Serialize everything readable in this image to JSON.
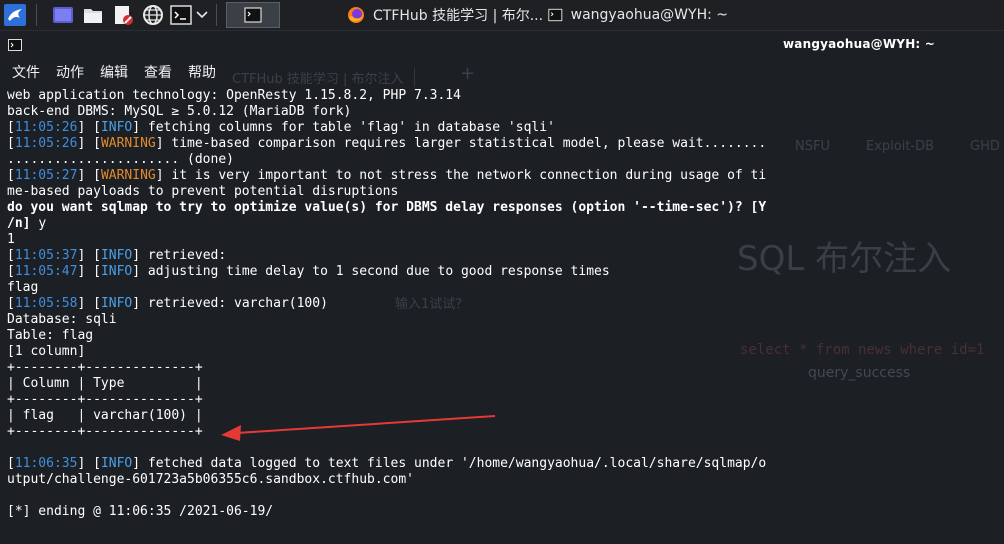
{
  "taskbar": {
    "tasks": [
      {
        "label": "CTFHub 技能学习 | 布尔..."
      },
      {
        "label": "wangyaohua@WYH: ~"
      }
    ]
  },
  "terminal": {
    "title": "wangyaohua@WYH: ~",
    "menu": [
      "文件",
      "动作",
      "编辑",
      "查看",
      "帮助"
    ]
  },
  "background_browser": {
    "tab_title": "CTFHub 技能学习 | 布尔注入",
    "heading": "SQL 布尔注入",
    "bookmarks": [
      "NSFU",
      "Exploit-DB",
      "GHD"
    ],
    "query_text": "select * from news where id=1",
    "status_text": "query_success",
    "placeholder_hint": "输入1试试？"
  },
  "lines": [
    [
      {
        "t": "web application technology: OpenResty 1.15.8.2, PHP 7.3.14"
      }
    ],
    [
      {
        "t": "back-end DBMS: MySQL ≥ 5.0.12 (MariaDB fork)"
      }
    ],
    [
      {
        "t": "["
      },
      {
        "t": "11:05:26",
        "c": "time"
      },
      {
        "t": "] ["
      },
      {
        "t": "INFO",
        "c": "info"
      },
      {
        "t": "] fetching columns for table 'flag' in database 'sqli'"
      }
    ],
    [
      {
        "t": "["
      },
      {
        "t": "11:05:26",
        "c": "time"
      },
      {
        "t": "] ["
      },
      {
        "t": "WARNING",
        "c": "warn"
      },
      {
        "t": "] time-based comparison requires larger statistical model, please wait........"
      }
    ],
    [
      {
        "t": "...................... (done)"
      }
    ],
    [
      {
        "t": "["
      },
      {
        "t": "11:05:27",
        "c": "time"
      },
      {
        "t": "] ["
      },
      {
        "t": "WARNING",
        "c": "warn"
      },
      {
        "t": "] it is very important to not stress the network connection during usage of ti"
      }
    ],
    [
      {
        "t": "me-based payloads to prevent potential disruptions"
      }
    ],
    [
      {
        "t": "do you want sqlmap to try to optimize value(s) for DBMS delay responses (option '--time-sec')? [Y",
        "c": "bold"
      }
    ],
    [
      {
        "t": "/n] ",
        "c": "bold"
      },
      {
        "t": "y"
      }
    ],
    [
      {
        "t": "1"
      }
    ],
    [
      {
        "t": "["
      },
      {
        "t": "11:05:37",
        "c": "time"
      },
      {
        "t": "] ["
      },
      {
        "t": "INFO",
        "c": "info"
      },
      {
        "t": "] retrieved:"
      }
    ],
    [
      {
        "t": "["
      },
      {
        "t": "11:05:47",
        "c": "time"
      },
      {
        "t": "] ["
      },
      {
        "t": "INFO",
        "c": "info"
      },
      {
        "t": "] adjusting time delay to 1 second due to good response times"
      }
    ],
    [
      {
        "t": "flag"
      }
    ],
    [
      {
        "t": "["
      },
      {
        "t": "11:05:58",
        "c": "time"
      },
      {
        "t": "] ["
      },
      {
        "t": "INFO",
        "c": "info"
      },
      {
        "t": "] retrieved: varchar(100)"
      }
    ],
    [
      {
        "t": "Database: sqli"
      }
    ],
    [
      {
        "t": "Table: flag"
      }
    ],
    [
      {
        "t": "[1 column]"
      }
    ],
    [
      {
        "t": "+--------+--------------+"
      }
    ],
    [
      {
        "t": "| Column | Type         |"
      }
    ],
    [
      {
        "t": "+--------+--------------+"
      }
    ],
    [
      {
        "t": "| flag   | varchar(100) |"
      }
    ],
    [
      {
        "t": "+--------+--------------+"
      }
    ],
    [
      {
        "t": ""
      }
    ],
    [
      {
        "t": "["
      },
      {
        "t": "11:06:35",
        "c": "time"
      },
      {
        "t": "] ["
      },
      {
        "t": "INFO",
        "c": "info"
      },
      {
        "t": "] fetched data logged to text files under '/home/wangyaohua/.local/share/sqlmap/o"
      }
    ],
    [
      {
        "t": "utput/challenge-601723a5b06355c6.sandbox.ctfhub.com'"
      }
    ],
    [
      {
        "t": ""
      }
    ],
    [
      {
        "t": "[*] ending @ 11:06:35 /2021-06-19/"
      }
    ]
  ],
  "colors": {
    "background": "#1c1f24",
    "timestamp": "#3f8fe0",
    "info": "#4aa0e8",
    "warning": "#e08a2e",
    "arrow": "#e53935"
  }
}
